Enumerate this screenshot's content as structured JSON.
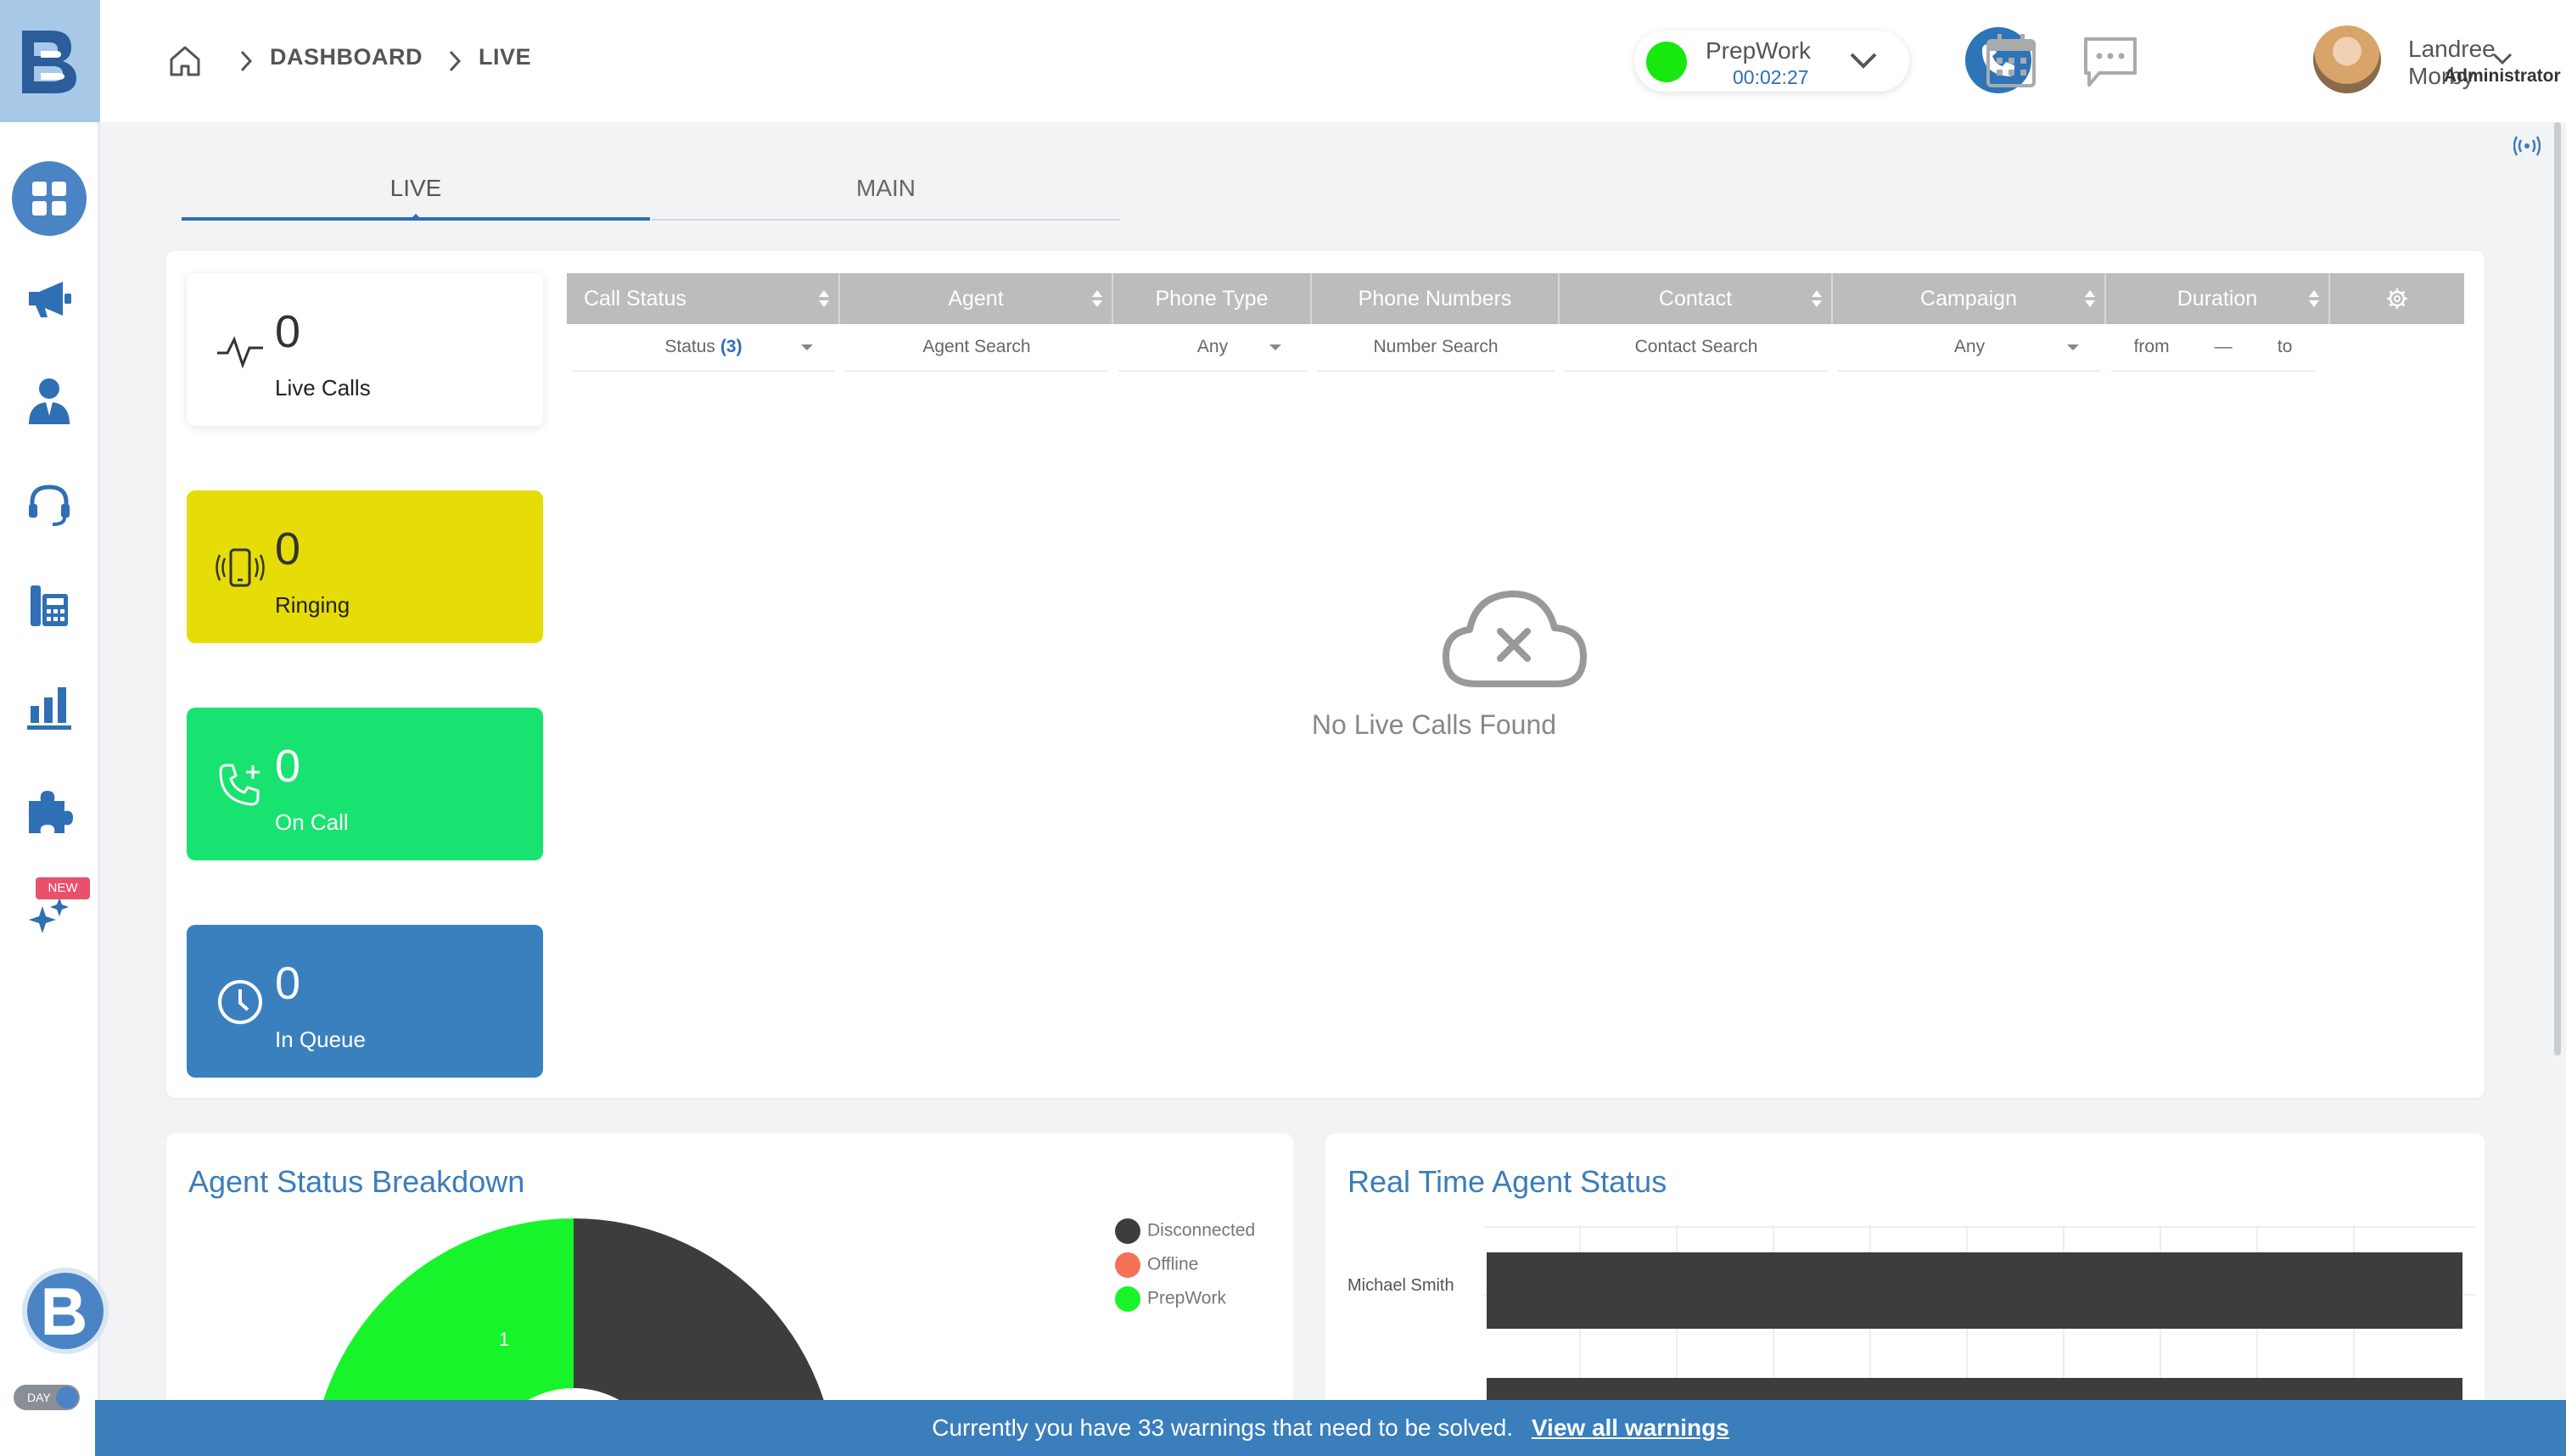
{
  "breadcrumb": {
    "home_icon": "home-icon",
    "items": [
      "DASHBOARD",
      "LIVE"
    ]
  },
  "agent_status": {
    "name": "PrepWork",
    "timer": "00:02:27",
    "color": "#17e80e"
  },
  "user": {
    "name": "Landree Morby",
    "role": "Administrator"
  },
  "sidebar": {
    "items": [
      "dashboard-icon",
      "megaphone-icon",
      "agent-icon",
      "headset-icon",
      "phone-system-icon",
      "reports-icon",
      "puzzle-icon",
      "sparkle-icon"
    ],
    "new_badge": "NEW",
    "day_toggle": "DAY"
  },
  "tabs": [
    {
      "label": "LIVE",
      "active": true
    },
    {
      "label": "MAIN",
      "active": false
    }
  ],
  "stats": [
    {
      "value": "0",
      "label": "Live Calls",
      "color": "#ffffff"
    },
    {
      "value": "0",
      "label": "Ringing",
      "color": "#e6dc08"
    },
    {
      "value": "0",
      "label": "On Call",
      "color": "#19e370"
    },
    {
      "value": "0",
      "label": "In Queue",
      "color": "#3a80bf"
    }
  ],
  "table": {
    "columns": [
      "Call Status",
      "Agent",
      "Phone Type",
      "Phone Numbers",
      "Contact",
      "Campaign",
      "Duration"
    ],
    "filters": {
      "status_prefix": "Status",
      "status_count": "(3)",
      "agent": "Agent Search",
      "phone_type": "Any",
      "number": "Number Search",
      "contact": "Contact Search",
      "campaign": "Any",
      "from": "from",
      "dash": "—",
      "to": "to"
    },
    "empty_message": "No Live Calls Found"
  },
  "agent_breakdown": {
    "title": "Agent Status Breakdown",
    "legend": [
      {
        "label": "Disconnected",
        "color": "#3d3d3d"
      },
      {
        "label": "Offline",
        "color": "#f57158"
      },
      {
        "label": "PrepWork",
        "color": "#17f52a"
      }
    ],
    "slice_label": "1"
  },
  "realtime": {
    "title": "Real Time Agent Status",
    "agents": [
      "Michael Smith"
    ]
  },
  "footer": {
    "message": "Currently you have 33 warnings that need to be solved.",
    "link": "View all warnings"
  }
}
